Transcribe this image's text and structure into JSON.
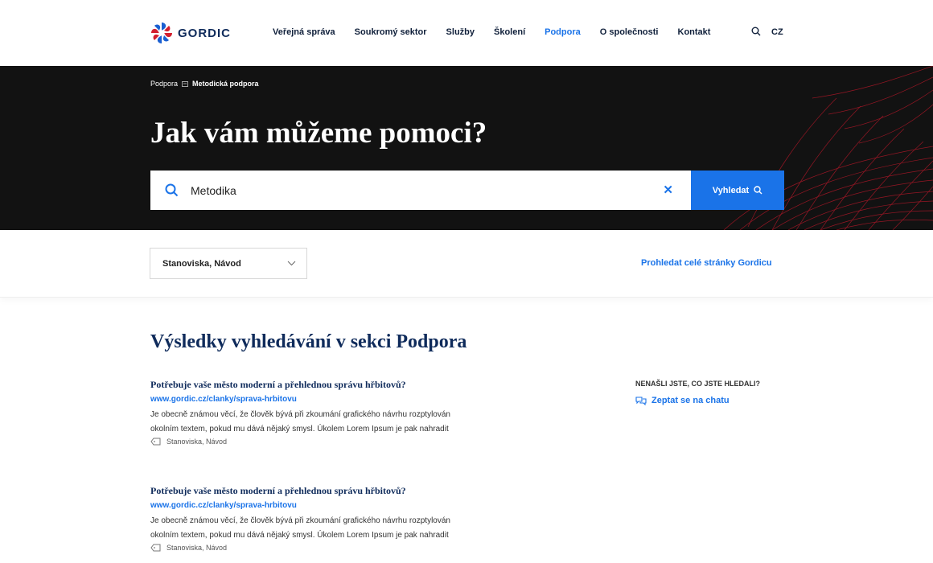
{
  "header": {
    "logo_text": "GORDIC",
    "nav": [
      {
        "label": "Veřejná správa",
        "active": false
      },
      {
        "label": "Soukromý sektor",
        "active": false
      },
      {
        "label": "Služby",
        "active": false
      },
      {
        "label": "Školení",
        "active": false
      },
      {
        "label": "Podpora",
        "active": true
      },
      {
        "label": "O společnosti",
        "active": false
      },
      {
        "label": "Kontakt",
        "active": false
      }
    ],
    "search_icon": "search-icon",
    "language": "CZ"
  },
  "hero": {
    "breadcrumb": {
      "parent": "Podpora",
      "current": "Metodická podpora"
    },
    "title": "Jak vám můžeme pomoci?",
    "search": {
      "value": "Metodika",
      "clear_symbol": "✕",
      "button_label": "Vyhledat"
    }
  },
  "filters": {
    "selected": "Stanoviska, Návod",
    "site_search_link": "Prohledat celé stránky Gordicu"
  },
  "results": {
    "heading": "Výsledky vyhledávání v sekci Podpora",
    "items": [
      {
        "title": "Potřebuje vaše město moderní a přehlednou správu hřbitovů?",
        "url": "www.gordic.cz/clanky/sprava-hrbitovu",
        "desc_line1": "Je obecně známou věcí, že člověk bývá při zkoumání grafického návrhu rozptylován",
        "desc_line2": "okolním textem, pokud mu dává nějaký smysl. Úkolem Lorem Ipsum je pak nahradit",
        "tags": "Stanoviska, Návod"
      },
      {
        "title": "Potřebuje vaše město moderní a přehlednou správu hřbitovů?",
        "url": "www.gordic.cz/clanky/sprava-hrbitovu",
        "desc_line1": "Je obecně známou věcí, že člověk bývá při zkoumání grafického návrhu rozptylován",
        "desc_line2": "okolním textem, pokud mu dává nějaký smysl. Úkolem Lorem Ipsum je pak nahradit",
        "tags": "Stanoviska, Návod"
      }
    ]
  },
  "aside": {
    "heading": "NENAŠLI JSTE, CO JSTE HLEDALI?",
    "chat_link": "Zeptat se na chatu"
  },
  "colors": {
    "accent": "#1a73e8",
    "navy": "#0f2b5b",
    "hero_bg": "#121212",
    "mesh": "#c0182a"
  }
}
